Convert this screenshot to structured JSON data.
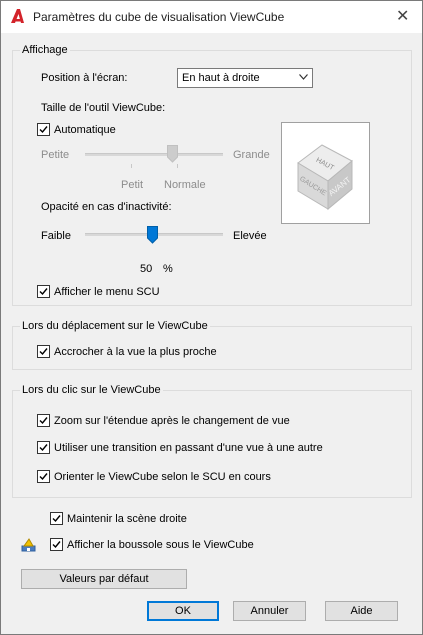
{
  "window": {
    "title": "Paramètres du cube de visualisation ViewCube",
    "close_glyph": "✕"
  },
  "display": {
    "group_label": "Affichage",
    "position_label": "Position à l'écran:",
    "position_value": "En haut à droite",
    "size_label": "Taille de l'outil ViewCube:",
    "auto_label": "Automatique",
    "auto_checked": true,
    "size_min_label": "Petite",
    "size_max_label": "Grande",
    "size_tick_labels": [
      "Petit",
      "Normale"
    ],
    "opacity_label": "Opacité en cas d'inactivité:",
    "opacity_min_label": "Faible",
    "opacity_max_label": "Elevée",
    "opacity_value": "50",
    "opacity_unit": "%",
    "show_ucs_label": "Afficher le menu SCU",
    "show_ucs_checked": true,
    "cube_faces": {
      "top": "HAUT",
      "left": "GAUCHE",
      "front": "AVANT"
    }
  },
  "drag": {
    "group_label": "Lors du déplacement sur le ViewCube",
    "snap_label": "Accrocher à la vue la plus proche",
    "snap_checked": true
  },
  "click": {
    "group_label": "Lors du clic sur le ViewCube",
    "zoom_label": "Zoom sur l'étendue après le changement de vue",
    "zoom_checked": true,
    "transition_label": "Utiliser une transition en passant d'une vue à une autre",
    "transition_checked": true,
    "orient_label": "Orienter le ViewCube selon le SCU en cours",
    "orient_checked": true
  },
  "options": {
    "upright_label": "Maintenir la scène droite",
    "upright_checked": true,
    "compass_label": "Afficher la boussole sous le ViewCube",
    "compass_checked": true
  },
  "buttons": {
    "defaults": "Valeurs par défaut",
    "ok": "OK",
    "cancel": "Annuler",
    "help": "Aide"
  },
  "colors": {
    "accent": "#0078d7",
    "autodesk_red": "#d3232a"
  }
}
